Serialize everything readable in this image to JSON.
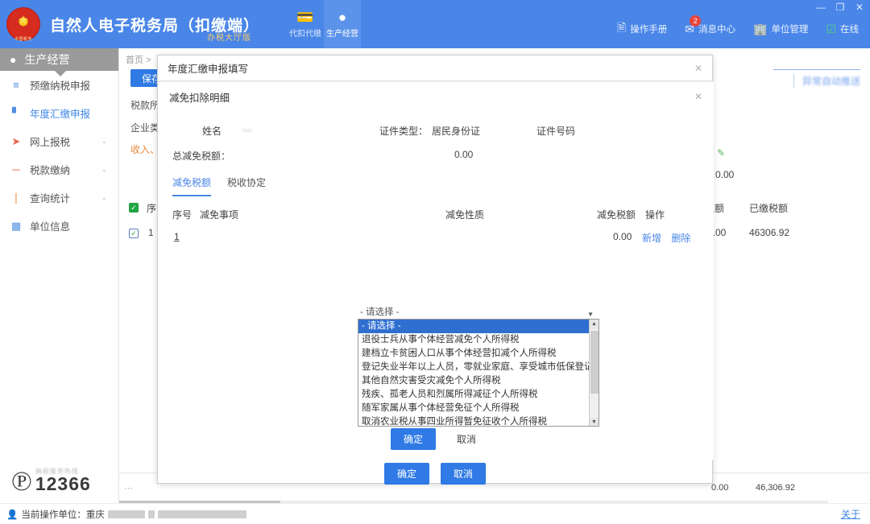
{
  "header": {
    "app_title": "自然人电子税务局（扣缴端）",
    "app_subtitle": "办税大厅版",
    "emblem_caption": "中国税务",
    "modes": [
      {
        "label": "代扣代缴",
        "icon": "wallet-icon"
      },
      {
        "label": "生产经营",
        "icon": "coins-icon"
      }
    ],
    "right_items": [
      {
        "label": "操作手册",
        "icon": "document-icon",
        "badge": ""
      },
      {
        "label": "消息中心",
        "icon": "envelope-icon",
        "badge": "2"
      },
      {
        "label": "单位管理",
        "icon": "building-icon",
        "badge": ""
      },
      {
        "label": "在线",
        "icon": "check-square-icon",
        "badge": ""
      }
    ],
    "window_controls": {
      "minimize": "—",
      "maximize": "❐",
      "close": "✕"
    }
  },
  "sidebar": {
    "section_title": "生产经营",
    "items": [
      {
        "label": "预缴纳税申报",
        "icon": "equalizer-icon",
        "chevron": "",
        "current": false
      },
      {
        "label": "年度汇缴申报",
        "icon": "chart-icon",
        "chevron": "",
        "current": true
      },
      {
        "label": "网上报税",
        "icon": "send-icon",
        "chevron": "⌄",
        "current": false
      },
      {
        "label": "税款缴纳",
        "icon": "money-icon",
        "chevron": "⌄",
        "current": false
      },
      {
        "label": "查询统计",
        "icon": "bar-icon",
        "chevron": "⌄",
        "current": false
      },
      {
        "label": "单位信息",
        "icon": "list-icon",
        "chevron": "",
        "current": false
      }
    ]
  },
  "background_page": {
    "breadcrumb": "首页 >",
    "save_button": "保存",
    "labels": {
      "tax_period": "税款所",
      "enterprise_type": "企业类",
      "income_group": "收入、"
    },
    "link_text": "异常自动推送",
    "value_zero": "0.00",
    "column_header_amount": "税额",
    "column_header_paid": "已缴税额",
    "row": {
      "index_header": "序号",
      "index": "1",
      "amount": "0.00",
      "paid": "46306.92"
    },
    "footer_amount": "0.00",
    "footer_paid": "46,306.92"
  },
  "modal_outer": {
    "title": "年度汇缴申报填写",
    "close_icon": "✕",
    "confirm": "确定",
    "cancel": "取消"
  },
  "modal_inner": {
    "title": "减免扣除明细",
    "close_icon": "✕",
    "fields": {
      "name_label": "姓名",
      "name_value": "",
      "id_type_label": "证件类型：",
      "id_type_value": "居民身份证",
      "id_no_label": "证件号码",
      "id_no_value": ""
    },
    "total_label": "总减免税额：",
    "total_value": "0.00",
    "tabs": [
      {
        "label": "减免税额",
        "active": true
      },
      {
        "label": "税收协定",
        "active": false
      }
    ],
    "table": {
      "columns": [
        "序号",
        "减免事项",
        "减免性质",
        "减免税额",
        "操作"
      ],
      "rows": [
        {
          "index": "1",
          "item_value": "- 请选择 -",
          "nature": "",
          "amount": "0.00",
          "actions": [
            "新增",
            "删除"
          ]
        }
      ]
    },
    "dropdown": {
      "open": true,
      "selected": "- 请选择 -",
      "options": [
        "- 请选择 -",
        "退役士兵从事个体经营减免个人所得税",
        "建档立卡贫困人口从事个体经营扣减个人所得税",
        "登记失业半年以上人员，零就业家庭、享受城市低保登记失业人",
        "其他自然灾害受灾减免个人所得税",
        "残疾、孤老人员和烈属所得减征个人所得税",
        "随军家属从事个体经营免征个人所得税",
        "取消农业税从事四业所得暂免征收个人所得税"
      ]
    },
    "confirm": "确定",
    "cancel": "取消"
  },
  "hotline": {
    "caption": "纳税服务热线",
    "number": "12366"
  },
  "bottom_bar": {
    "current_unit_label": "当前操作单位：重庆",
    "close_link": "关于"
  },
  "colors": {
    "brand_blue": "#4a86e8",
    "primary_button": "#2f7ae5",
    "link_blue": "#4a86e8",
    "badge_red": "#e8453c",
    "highlight_select": "#2f6fd0",
    "sidebar_header_gray": "#9a9a9a",
    "accent_orange": "#e8883a"
  }
}
